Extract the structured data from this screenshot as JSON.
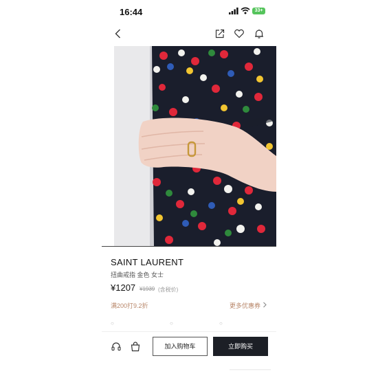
{
  "status_bar": {
    "time": "16:44",
    "battery": "33+"
  },
  "nav": {
    "back_icon": "chevron-left-icon",
    "share_icon": "share-icon",
    "favorite_icon": "heart-icon",
    "notify_icon": "bell-icon"
  },
  "product": {
    "brand": "SAINT LAURENT",
    "subtitle": "扭曲戒指 金色 女士",
    "price": "¥1207",
    "old_price": "¥1939",
    "tax_note": "(含税价)",
    "promo": "满200打9.2折",
    "more_coupons": "更多优惠券"
  },
  "bottom_bar": {
    "service_icon": "headset-icon",
    "bag_icon": "shopping-bag-icon",
    "add_to_cart": "加入购物车",
    "buy_now": "立即购买"
  },
  "colors": {
    "accent_promo": "#b8876a",
    "buy_button": "#1c1f26",
    "battery": "#55c45c",
    "dress_bg": "#1a1e2c"
  }
}
